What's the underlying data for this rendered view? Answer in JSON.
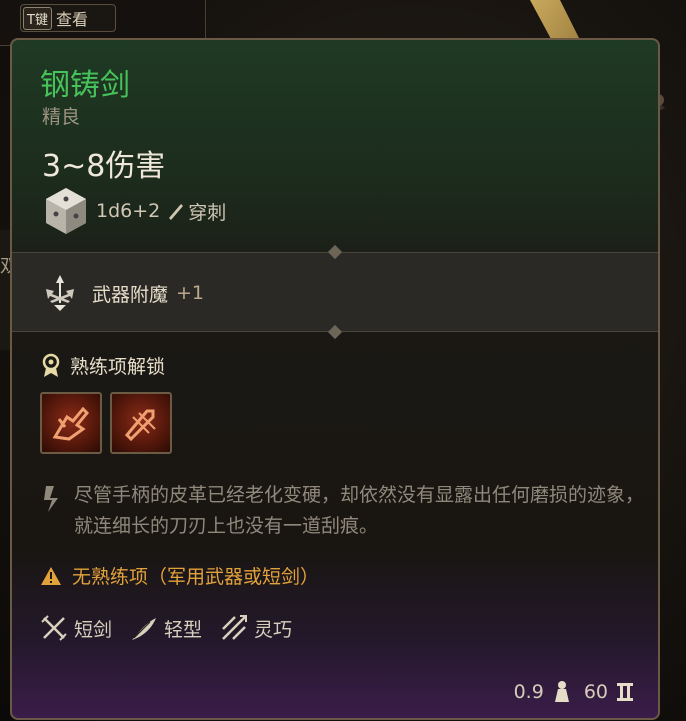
{
  "hotkey": {
    "key": "T键",
    "label": "查看"
  },
  "background": {
    "edge_char": "双"
  },
  "item": {
    "name": "钢铸剑",
    "rarity": "精良",
    "damage_range": "3~8伤害",
    "damage_dice": "1d6+2",
    "damage_type": "穿刺",
    "enchant_label": "武器附魔",
    "enchant_value": "+1",
    "proficiency_header": "熟练项解锁",
    "actions": [
      {
        "icon": "weapon-action-icon-1"
      },
      {
        "icon": "weapon-action-icon-2"
      }
    ],
    "description": "尽管手柄的皮革已经老化变硬，却依然没有显露出任何磨损的迹象，就连细长的刀刃上也没有一道刮痕。",
    "warning": "无熟练项（军用武器或短剑）",
    "properties": [
      {
        "icon": "short-sword-icon",
        "label": "短剑"
      },
      {
        "icon": "feather-icon",
        "label": "轻型"
      },
      {
        "icon": "finesse-icon",
        "label": "灵巧"
      }
    ],
    "weight": "0.9",
    "price": "60"
  },
  "colors": {
    "name": "#46c25a",
    "warning": "#e2a23b",
    "border": "#6a5a45"
  }
}
